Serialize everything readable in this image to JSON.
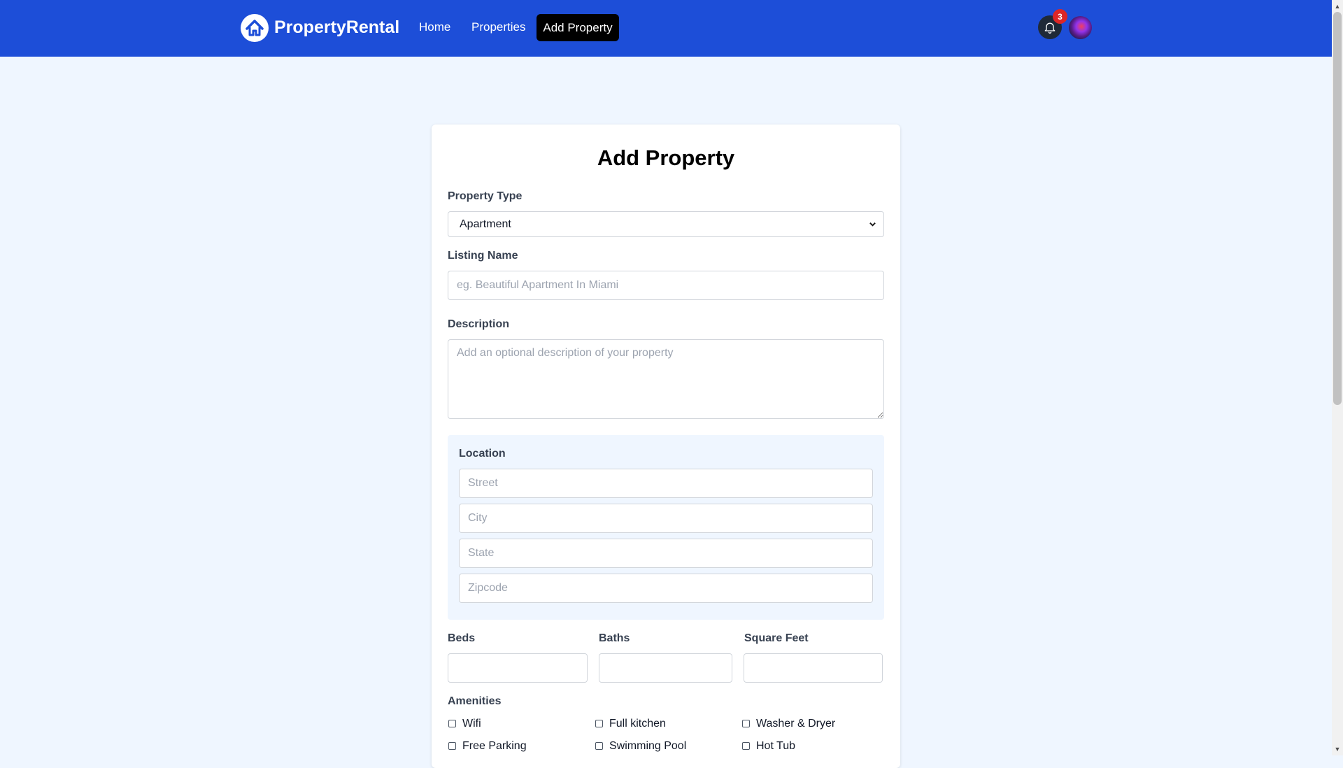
{
  "nav": {
    "brand": "PropertyRental",
    "links": [
      "Home",
      "Properties"
    ],
    "active_link": "Add Property",
    "notification_count": "3",
    "icons": {
      "logo": "house-icon",
      "bell": "bell-icon"
    },
    "colors": {
      "nav_bg": "#1d4ed8",
      "active_bg": "#000000",
      "badge": "#dc2626"
    }
  },
  "form": {
    "title": "Add Property",
    "property_type": {
      "label": "Property Type",
      "value": "Apartment"
    },
    "listing_name": {
      "label": "Listing Name",
      "placeholder": "eg. Beautiful Apartment In Miami"
    },
    "description": {
      "label": "Description",
      "placeholder": "Add an optional description of your property"
    },
    "location": {
      "label": "Location",
      "street_placeholder": "Street",
      "city_placeholder": "City",
      "state_placeholder": "State",
      "zipcode_placeholder": "Zipcode"
    },
    "beds_label": "Beds",
    "baths_label": "Baths",
    "square_feet_label": "Square Feet",
    "amenities": {
      "label": "Amenities",
      "items": [
        "Wifi",
        "Full kitchen",
        "Washer & Dryer",
        "Free Parking",
        "Swimming Pool",
        "Hot Tub"
      ]
    }
  }
}
